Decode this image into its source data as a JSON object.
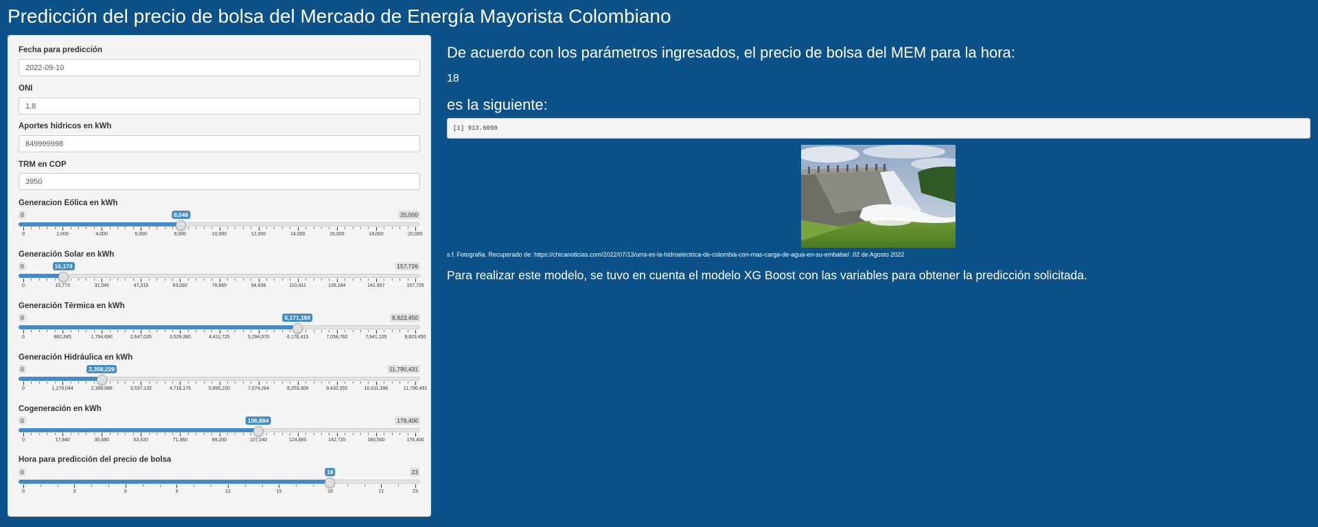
{
  "app": {
    "title": "Predicción del precio de bolsa del Mercado de Energía Mayorista Colombiano"
  },
  "sidebar": {
    "inputs": [
      {
        "label": "Fecha para predicción",
        "value": "2022-09-10"
      },
      {
        "label": "ONI",
        "value": "1,8"
      },
      {
        "label": "Aportes hídricos en kWh",
        "value": "849999998"
      },
      {
        "label": "TRM en COP",
        "value": "3950"
      }
    ],
    "sliders": [
      {
        "label": "Generacion Eólica en kWh",
        "min": 0,
        "max": 20000,
        "value": 8046,
        "min_label": "0",
        "max_label": "20,000",
        "value_label": "8,046",
        "ticks": [
          "0",
          "2,000",
          "4,000",
          "6,000",
          "8,000",
          "10,000",
          "12,000",
          "14,000",
          "16,000",
          "18,000",
          "20,000"
        ]
      },
      {
        "label": "Generación Solar en kWh",
        "min": 0,
        "max": 157726,
        "value": 16174,
        "min_label": "0",
        "max_label": "157,726",
        "value_label": "16,174",
        "ticks": [
          "0",
          "15,773",
          "31,546",
          "47,319",
          "63,092",
          "78,865",
          "94,638",
          "110,411",
          "126,184",
          "141,957",
          "157,726"
        ]
      },
      {
        "label": "Generación Térmica en kWh",
        "min": 0,
        "max": 8823450,
        "value": 6171169,
        "min_label": "0",
        "max_label": "8,823,450",
        "value_label": "6,171,169",
        "ticks": [
          "0",
          "882,345",
          "1,764,690",
          "2,647,035",
          "3,529,380",
          "4,411,725",
          "5,294,070",
          "6,176,415",
          "7,058,760",
          "7,941,105",
          "8,823,450"
        ]
      },
      {
        "label": "Generación Hidráulica en kWh",
        "min": 0,
        "max": 11790431,
        "value": 2358229,
        "min_label": "0",
        "max_label": "11,790,431",
        "value_label": "2,358,229",
        "ticks": [
          "0",
          "1,179,044",
          "2,358,088",
          "3,537,132",
          "4,716,176",
          "5,895,220",
          "7,074,264",
          "8,253,308",
          "9,432,352",
          "10,611,396",
          "11,790,431"
        ]
      },
      {
        "label": "Cogeneración en kWh",
        "min": 0,
        "max": 178400,
        "value": 106884,
        "min_label": "0",
        "max_label": "178,400",
        "value_label": "106,884",
        "ticks": [
          "0",
          "17,840",
          "35,680",
          "53,520",
          "71,360",
          "89,200",
          "107,040",
          "124,880",
          "142,720",
          "160,560",
          "178,400"
        ]
      },
      {
        "label": "Hora para predicción del precio de bolsa",
        "min": 0,
        "max": 23,
        "value": 18,
        "min_label": "0",
        "max_label": "23",
        "value_label": "18",
        "ticks": [
          "0",
          "3",
          "6",
          "9",
          "12",
          "15",
          "18",
          "21",
          "23"
        ]
      }
    ]
  },
  "main": {
    "heading1": "De acuerdo con los parámetros ingresados, el precio de bolsa del MEM para la hora:",
    "hour": "18",
    "heading2": "es la siguiente:",
    "output": "[1] 913.6098",
    "caption": "s.f. Fotografía. Recuperado de: https://chicanoticias.com/2022/07/13/urra-es-la-hidroelectrica-de-colombia-con-mas-carga-de-agua-en-su-embalse/ .02 de Agosto 2022",
    "explanation": "Para realizar este modelo, se tuvo en cuenta el modelo XG Boost con las variables para obtener la predicción solicitada."
  },
  "colors": {
    "background": "#0d5189",
    "accent": "#428bca",
    "panel": "#f5f5f5"
  }
}
